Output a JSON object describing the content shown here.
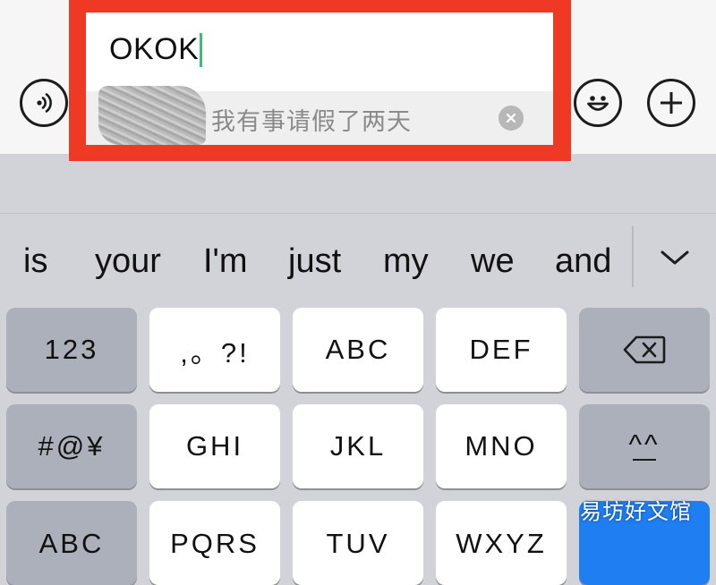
{
  "chat_input": {
    "typed_text": "OKOK",
    "quoted_message": "我有事请假了两天"
  },
  "suggestions": [
    "is",
    "your",
    "I'm",
    "just",
    "my",
    "we",
    "and"
  ],
  "keyboard": {
    "row1": [
      "123",
      ",。?!",
      "ABC",
      "DEF"
    ],
    "row2": [
      "#@¥",
      "GHI",
      "JKL",
      "MNO",
      "^^"
    ],
    "row3": [
      "ABC",
      "PQRS",
      "TUV",
      "WXYZ"
    ]
  },
  "watermark": "易坊好文馆",
  "colors": {
    "highlight": "#ee3a24",
    "caret": "#3dbb7d",
    "keyboard_bg": "#d1d3d9",
    "function_key": "#acb0ba",
    "primary_key": "#1f7ef2"
  },
  "icons": {
    "voice": "voice-icon",
    "emoji": "emoji-icon",
    "plus": "plus-icon",
    "clear": "clear-icon",
    "expand": "chevron-down-icon",
    "delete": "backspace-icon"
  }
}
